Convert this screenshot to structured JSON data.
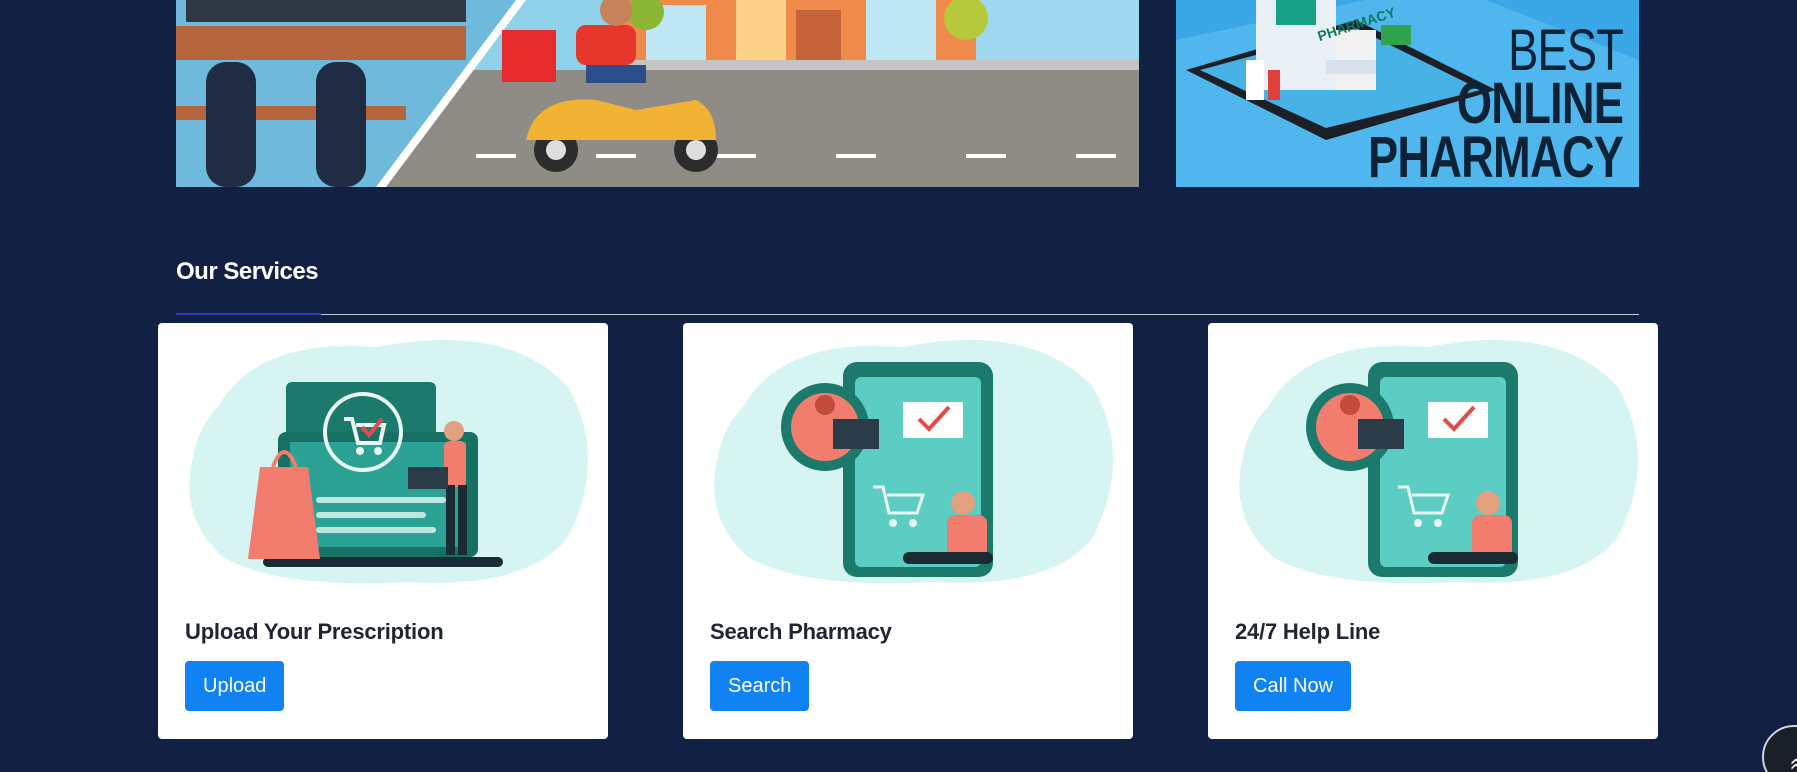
{
  "banners": {
    "right_text": [
      "BEST",
      "ONLINE",
      "PHARMACY"
    ],
    "right_sign": "PHARMACY"
  },
  "services": {
    "title": "Our Services",
    "cards": [
      {
        "title": "Upload Your Prescription",
        "button": "Upload"
      },
      {
        "title": "Search Pharmacy",
        "button": "Search"
      },
      {
        "title": "24/7 Help Line",
        "button": "Call Now"
      }
    ]
  },
  "scroll_top": {
    "icon": "double-chevron-up-icon",
    "glyph": "«"
  },
  "colors": {
    "background": "#122143",
    "accent": "#1082f2",
    "card": "#ffffff",
    "illustration_teal": "#1b7a6b",
    "illustration_coral": "#f27d6e"
  }
}
